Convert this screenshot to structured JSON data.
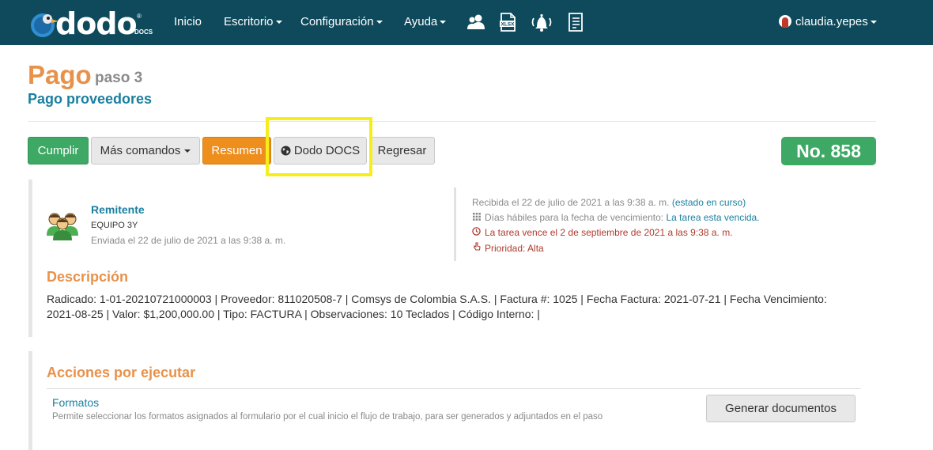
{
  "navbar": {
    "logo_text": "dodo",
    "logo_reg": "®",
    "logo_sub": "DOCS",
    "items": [
      {
        "label": "Inicio",
        "dropdown": false
      },
      {
        "label": "Escritorio",
        "dropdown": true
      },
      {
        "label": "Configuración",
        "dropdown": true
      },
      {
        "label": "Ayuda",
        "dropdown": true
      }
    ],
    "icons": [
      "users-icon",
      "xlsx-file-icon",
      "bell-alarm-icon",
      "document-list-icon"
    ],
    "user": "claudia.yepes",
    "bg_color": "#0e4a5c"
  },
  "header": {
    "title": "Pago",
    "step": "paso 3",
    "subtitle": "Pago proveedores"
  },
  "toolbar": {
    "cumplir": "Cumplir",
    "mas_comandos": "Más comandos",
    "resumen": "Resumen",
    "dodo_docs": "Dodo DOCS",
    "regresar": "Regresar",
    "number": "No. 858"
  },
  "sender": {
    "label": "Remitente",
    "name": "EQUIPO 3Y",
    "date": "Enviada el 22 de julio de 2021 a las 9:38 a. m."
  },
  "meta": {
    "received": "Recibida el 22 de julio de 2021 a las 9:38 a. m.",
    "status": "(estado en curso)",
    "days_label": "Días hábiles para la fecha de vencimiento:",
    "days_value": "La tarea esta vencida.",
    "due": "La tarea vence el 2 de septiembre de 2021 a las 9:38 a. m.",
    "priority": "Prioridad: Alta"
  },
  "description": {
    "title": "Descripción",
    "text": "Radicado: 1-01-20210721000003 | Proveedor: 811020508-7 | Comsys de Colombia S.A.S. | Factura #: 1025 | Fecha Factura: 2021-07-21 | Fecha Vencimiento: 2021-08-25 | Valor: $1,200,000.00 | Tipo: FACTURA | Observaciones: 10 Teclados | Código Interno: |"
  },
  "actions": {
    "title": "Acciones por ejecutar",
    "formatos_title": "Formatos",
    "formatos_desc": "Permite seleccionar los formatos asignados al formulario por el cual inicio el flujo de trabajo, para ser generados y adjuntados en el paso",
    "generate_button": "Generar documentos"
  },
  "colors": {
    "orange": "#e8914a",
    "teal": "#1a7fa0",
    "green": "#3ea865",
    "highlight": "#f5ee1b"
  }
}
